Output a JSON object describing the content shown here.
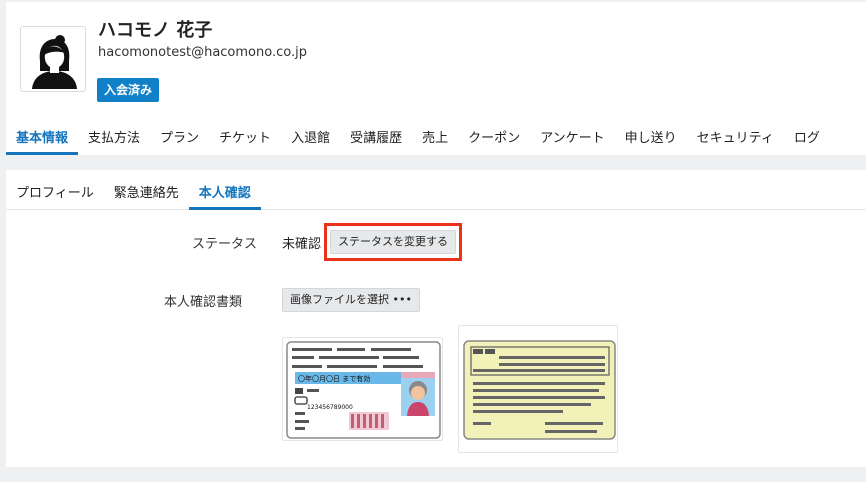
{
  "profile": {
    "name": "ハコモノ 花子",
    "email": "hacomonotest@hacomono.co.jp",
    "badge": "入会済み"
  },
  "main_tabs": [
    "基本情報",
    "支払方法",
    "プラン",
    "チケット",
    "入退館",
    "受講履歴",
    "売上",
    "クーポン",
    "アンケート",
    "申し送り",
    "セキュリティ",
    "ログ"
  ],
  "sub_tabs": [
    "プロフィール",
    "緊急連絡先",
    "本人確認"
  ],
  "verification": {
    "status_label": "ステータス",
    "status_value": "未確認",
    "change_status_button": "ステータスを変更する",
    "documents_label": "本人確認書類",
    "select_file_button": "画像ファイルを選択 •••"
  },
  "license_card": {
    "date_line": "〇年〇月〇日 まで有効",
    "number": "123456789000"
  },
  "colors": {
    "accent": "#1575bd",
    "badge": "#1080c8",
    "highlight": "#e8321a"
  }
}
